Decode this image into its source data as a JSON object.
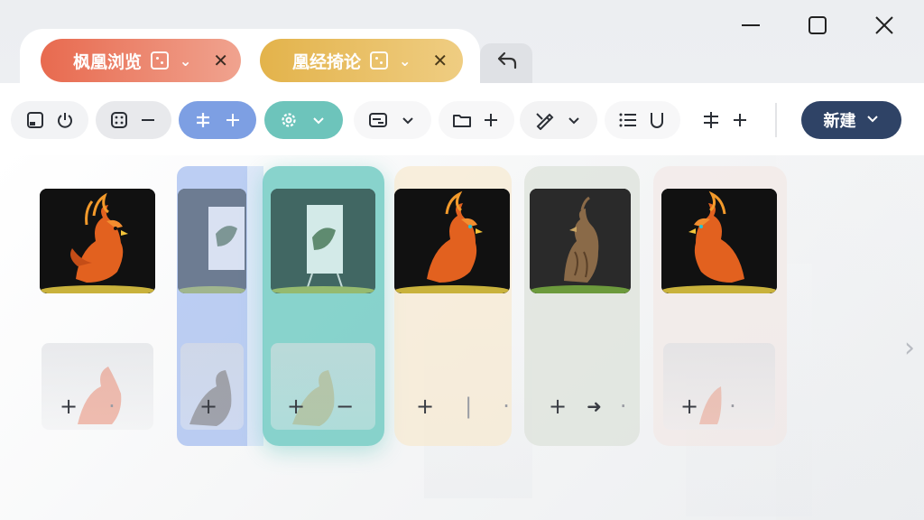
{
  "window": {
    "minimize_icon": "minimize-icon",
    "maximize_icon": "maximize-icon",
    "close_icon": "close-icon"
  },
  "tabs": [
    {
      "label": "枫凰浏览",
      "icon": "tab-grid-icon",
      "color": "#e86a4f"
    },
    {
      "label": "凰经掎论",
      "icon": "tab-grid-icon",
      "color": "#e3b34b"
    }
  ],
  "tab_back_icon": "undo-arrow-icon",
  "toolbar": {
    "groups": [
      {
        "icons": [
          "window-icon",
          "power-icon"
        ]
      },
      {
        "icons": [
          "grid-icon",
          "minus-icon"
        ]
      },
      {
        "icons": [
          "asterisk-icon",
          "plus-icon"
        ],
        "color": "#7d9fe3"
      },
      {
        "icons": [
          "gear-icon",
          "chevron-down-icon"
        ],
        "color": "#6dc4bb"
      },
      {
        "icons": [
          "card-icon",
          "chevron-down-icon"
        ]
      },
      {
        "icons": [
          "folder-icon",
          "plus-icon"
        ]
      },
      {
        "icons": [
          "pen-icon",
          "chevron-down-icon"
        ]
      },
      {
        "icons": [
          "list-icon",
          "u-icon"
        ]
      },
      {
        "icons": [
          "asterisk-icon",
          "plus-icon"
        ]
      }
    ],
    "new_button": "新建",
    "new_button_color": "#2f4366"
  },
  "content": {
    "columns": [
      {
        "tint": "#94b2ee"
      },
      {
        "tint": "#68c8bf"
      },
      {
        "tint": "#f7e8cd"
      },
      {
        "tint": "#dce1d8"
      },
      {
        "tint": "#f2e6e4"
      }
    ],
    "next_icon": "chevron-right-icon"
  }
}
